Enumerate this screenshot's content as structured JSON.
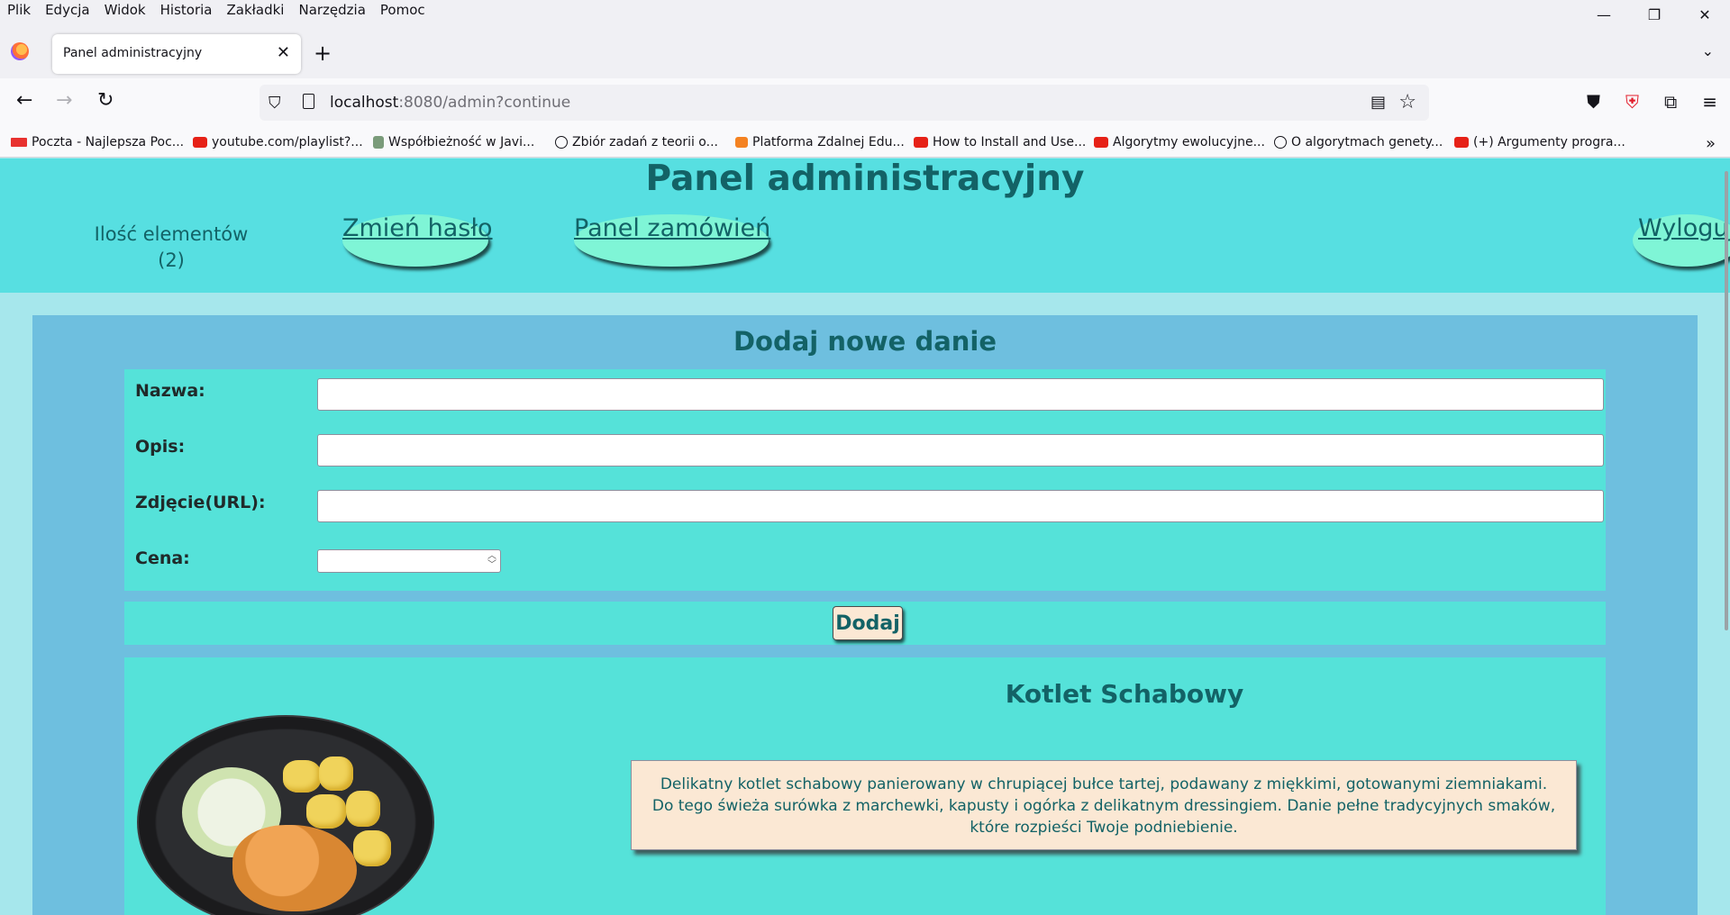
{
  "browser": {
    "menu": [
      "Plik",
      "Edycja",
      "Widok",
      "Historia",
      "Zakładki",
      "Narzędzia",
      "Pomoc"
    ],
    "tab_title": "Panel administracyjny",
    "url_host": "localhost",
    "url_rest": ":8080/admin?continue",
    "bookmarks": [
      {
        "label": "Poczta - Najlepsza Poc...",
        "icon": "wp-icon"
      },
      {
        "label": "youtube.com/playlist?...",
        "icon": "youtube-icon"
      },
      {
        "label": "Współbieżność w Javi...",
        "icon": "site-icon"
      },
      {
        "label": "Zbiór zadań z teorii o...",
        "icon": "globe-icon"
      },
      {
        "label": "Platforma Zdalnej Edu...",
        "icon": "moodle-icon"
      },
      {
        "label": "How to Install and Use...",
        "icon": "youtube-icon"
      },
      {
        "label": "Algorytmy ewolucyjne...",
        "icon": "youtube-icon"
      },
      {
        "label": "O algorytmach genety...",
        "icon": "globe-icon"
      },
      {
        "label": "(+) Argumenty progra...",
        "icon": "youtube-icon"
      }
    ]
  },
  "header": {
    "title": "Panel administracyjny",
    "count_label": "Ilość elementów",
    "count_value": "(2)",
    "change_password": "Zmień hasło",
    "orders_panel": "Panel zamówień",
    "logout": "Wyloguj"
  },
  "form": {
    "title": "Dodaj nowe danie",
    "name_label": "Nazwa:",
    "desc_label": "Opis:",
    "image_label": "Zdjęcie(URL):",
    "price_label": "Cena:",
    "name_value": "",
    "desc_value": "",
    "image_value": "",
    "price_value": "",
    "submit": "Dodaj"
  },
  "dish": {
    "name": "Kotlet Schabowy",
    "description": "Delikatny kotlet schabowy panierowany w chrupiącej bułce tartej, podawany z miękkimi, gotowanymi ziemniakami. Do tego świeża surówka z marchewki, kapusty i ogórka z delikatnym dressingiem. Danie pełne tradycyjnych smaków, które rozpieści Twoje podniebienie."
  },
  "colors": {
    "header_bg": "#57dfe1",
    "panel_bg": "#6ebfdf",
    "form_bg": "#55e2d9",
    "text_dark_teal": "#136266",
    "oval_bg": "#7ff5d6",
    "cream": "#fbe8d4"
  }
}
